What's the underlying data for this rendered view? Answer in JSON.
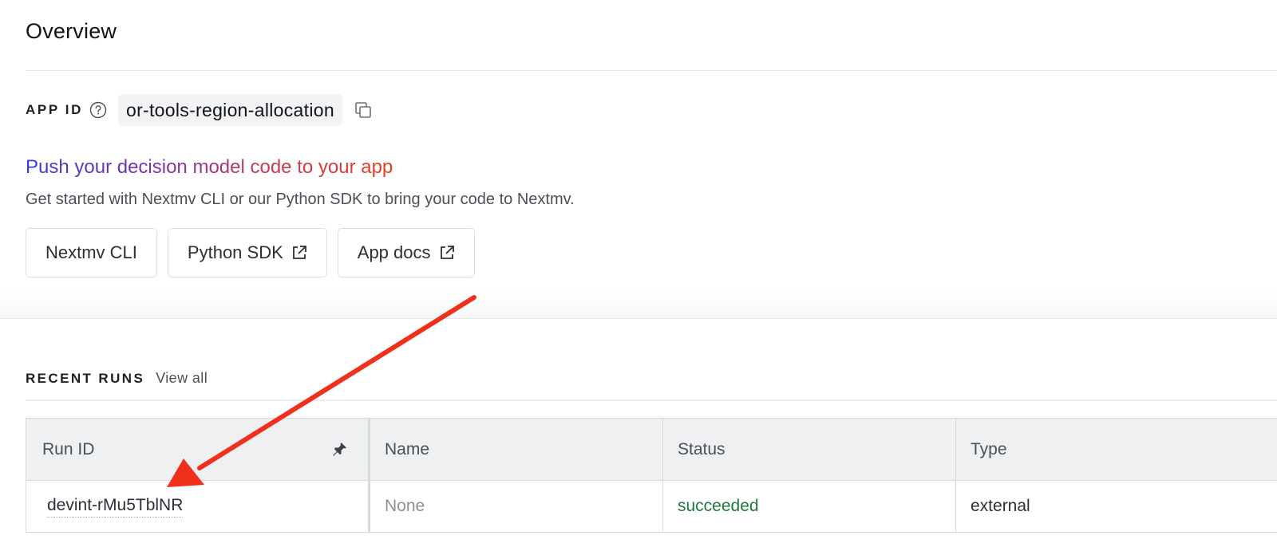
{
  "page": {
    "title": "Overview"
  },
  "app_id": {
    "label": "APP ID",
    "value": "or-tools-region-allocation"
  },
  "push": {
    "heading": "Push your decision model code to your app",
    "subtext": "Get started with Nextmv CLI or our Python SDK to bring your code to Nextmv."
  },
  "buttons": [
    {
      "label": "Nextmv CLI"
    },
    {
      "label": "Python SDK"
    },
    {
      "label": "App docs"
    }
  ],
  "recent_runs": {
    "label": "RECENT RUNS",
    "view_all": "View all",
    "columns": [
      "Run ID",
      "Name",
      "Status",
      "Type"
    ],
    "rows": [
      {
        "run_id": "devint-rMu5TblNR",
        "name": "None",
        "status": "succeeded",
        "type": "external"
      }
    ]
  },
  "colors": {
    "status_success": "#1e7a3d",
    "annotation_arrow": "#f0301c"
  }
}
